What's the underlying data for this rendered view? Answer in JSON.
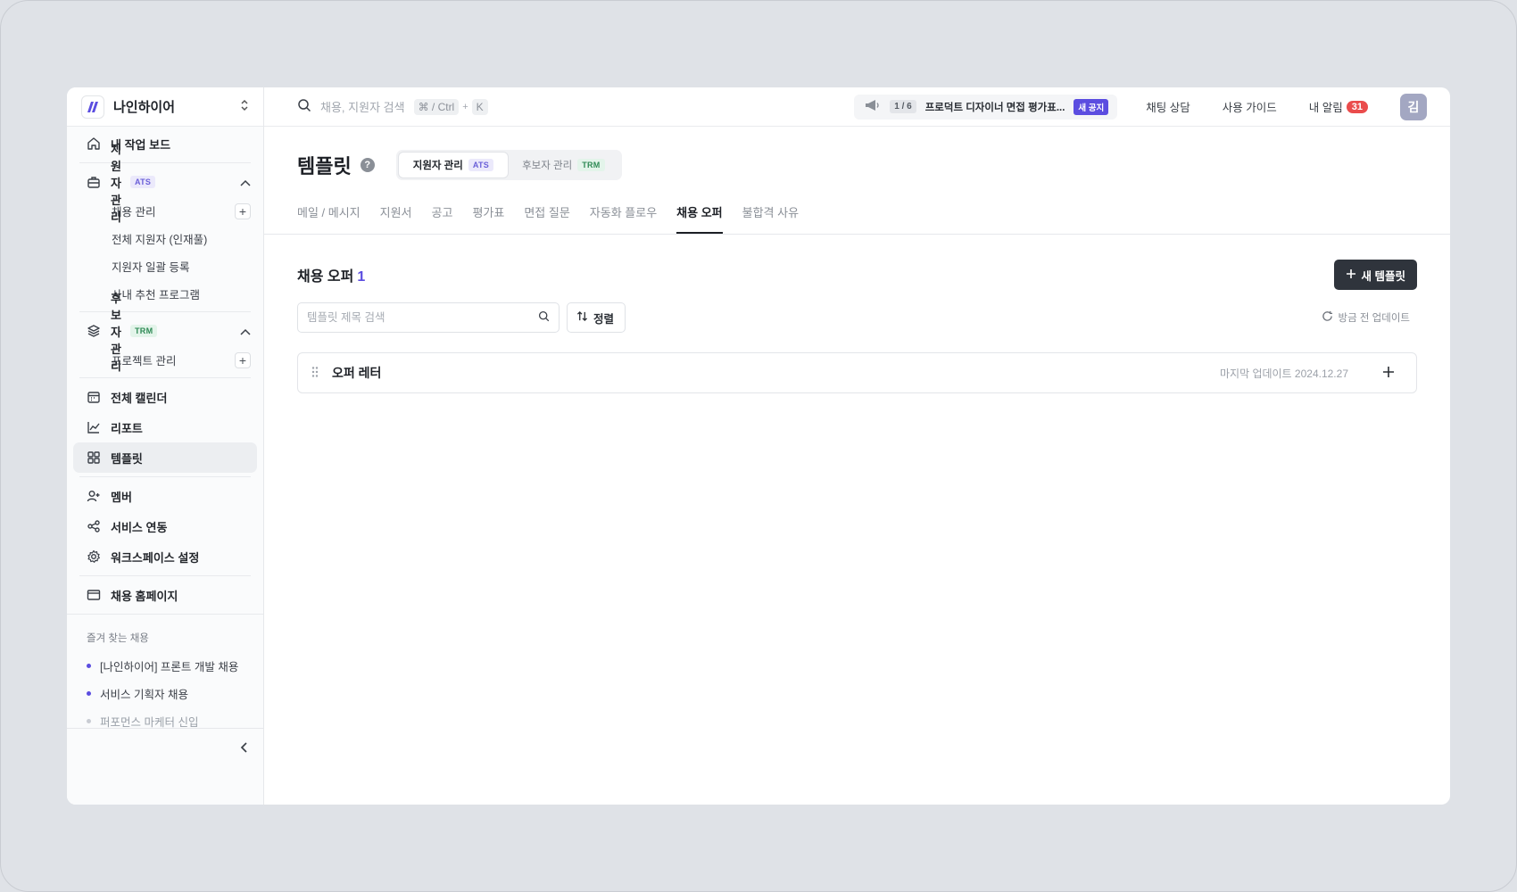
{
  "workspace": {
    "name": "나인하이어"
  },
  "sidebar": {
    "dashboard": "내 작업 보드",
    "applicant_group": {
      "label": "지원자 관리",
      "tag": "ATS",
      "items": [
        "채용 관리",
        "전체 지원자 (인재풀)",
        "지원자 일괄 등록",
        "사내 추천 프로그램"
      ]
    },
    "candidate_group": {
      "label": "후보자 관리",
      "tag": "TRM",
      "items": [
        "프로젝트 관리"
      ]
    },
    "calendar": "전체 캘린더",
    "report": "리포트",
    "template": "템플릿",
    "member": "멤버",
    "integration": "서비스 연동",
    "workspace_settings": "워크스페이스 설정",
    "career_page": "채용 홈페이지",
    "favorites_title": "즐겨 찾는 채용",
    "favorites": [
      "[나인하이어] 프론트 개발 채용",
      "서비스 기획자 채용",
      "퍼포먼스 마케터 신입"
    ]
  },
  "topbar": {
    "search_placeholder": "채용, 지원자 검색",
    "shortcut_mod": "⌘ / Ctrl",
    "shortcut_plus": "+",
    "shortcut_key": "K",
    "notice_count": "1 / 6",
    "notice_text": "프로덕트 디자이너 면접 평가표...",
    "notice_badge": "새 공지",
    "chat": "채팅 상담",
    "guide": "사용 가이드",
    "alarm": "내 알림",
    "alarm_count": "31",
    "avatar": "김"
  },
  "page": {
    "title": "템플릿",
    "help": "?",
    "segments": [
      {
        "label": "지원자 관리",
        "tag": "ATS"
      },
      {
        "label": "후보자 관리",
        "tag": "TRM"
      }
    ],
    "tabs": [
      "메일 / 메시지",
      "지원서",
      "공고",
      "평가표",
      "면접 질문",
      "자동화 플로우",
      "채용 오퍼",
      "불합격 사유"
    ],
    "active_tab": "채용 오퍼"
  },
  "content": {
    "section_title": "채용 오퍼",
    "section_count": "1",
    "new_button": "새 템플릿",
    "search_placeholder": "템플릿 제목 검색",
    "sort": "정렬",
    "refresh": "방금 전 업데이트",
    "templates": [
      {
        "name": "오퍼 레터",
        "updated": "마지막 업데이트 2024.12.27"
      }
    ]
  },
  "colors": {
    "accent": "#5b4de0",
    "primary_button": "#2f343c",
    "alert": "#ea4c4c"
  }
}
